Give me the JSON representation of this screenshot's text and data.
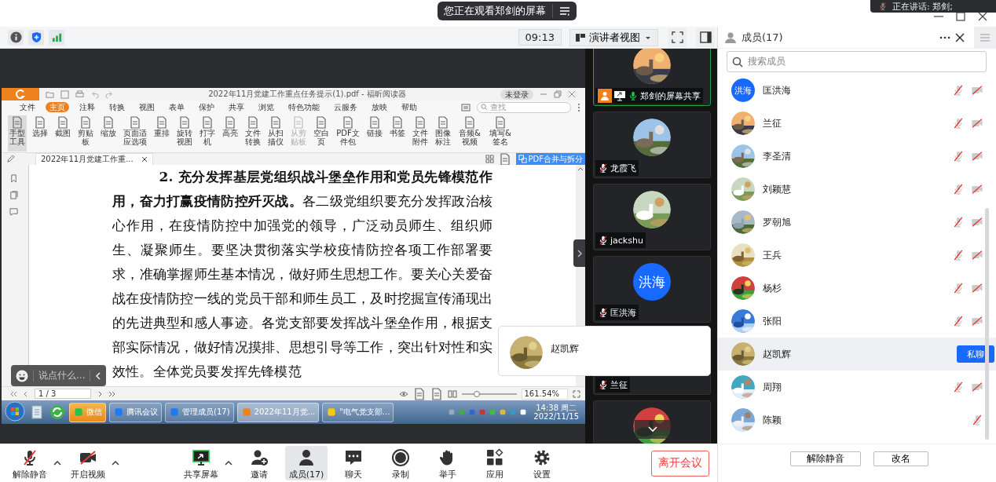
{
  "window": {
    "notice": "您正在观看郑剑的屏幕",
    "speaking": "正在讲话: 郑剑;"
  },
  "meeting_toolbar": {
    "timer": "09:13",
    "view_mode": "演讲者视图"
  },
  "shared_screen": {
    "reader": {
      "title": "2022年11月党建工作重点任务提示(1).pdf - 福昕阅读器",
      "login": "未登录",
      "menu_tabs": [
        {
          "label": "文件",
          "selected": false
        },
        {
          "label": "主页",
          "selected": true
        },
        {
          "label": "注释",
          "selected": false
        },
        {
          "label": "转换",
          "selected": false
        },
        {
          "label": "视图",
          "selected": false
        },
        {
          "label": "表单",
          "selected": false
        },
        {
          "label": "保护",
          "selected": false
        },
        {
          "label": "共享",
          "selected": false
        },
        {
          "label": "浏览",
          "selected": false
        },
        {
          "label": "特色功能",
          "selected": false
        },
        {
          "label": "云服务",
          "selected": false
        },
        {
          "label": "放映",
          "selected": false
        },
        {
          "label": "帮助",
          "selected": false
        }
      ],
      "search_placeholder": "查找",
      "tools": [
        {
          "label": "手型工具",
          "selected": true,
          "disabled": false
        },
        {
          "label": "选择",
          "selected": false,
          "disabled": false
        },
        {
          "label": "截图",
          "selected": false,
          "disabled": false
        },
        {
          "label": "剪贴板",
          "selected": false,
          "disabled": false
        },
        {
          "label": "缩放",
          "selected": false,
          "disabled": false
        },
        {
          "label": "页面适应选项",
          "selected": false,
          "disabled": false
        },
        {
          "label": "重排",
          "selected": false,
          "disabled": false
        },
        {
          "label": "旋转视图",
          "selected": false,
          "disabled": false
        },
        {
          "label": "打字机",
          "selected": false,
          "disabled": false
        },
        {
          "label": "高亮",
          "selected": false,
          "disabled": false
        },
        {
          "label": "文件转换",
          "selected": false,
          "disabled": false
        },
        {
          "label": "从扫描仪",
          "selected": false,
          "disabled": false
        },
        {
          "label": "从剪贴板",
          "selected": false,
          "disabled": true
        },
        {
          "label": "空白页",
          "selected": false,
          "disabled": false
        },
        {
          "label": "PDF文件包",
          "selected": false,
          "disabled": false
        },
        {
          "label": "链接",
          "selected": false,
          "disabled": false
        },
        {
          "label": "书签",
          "selected": false,
          "disabled": false
        },
        {
          "label": "文件附件",
          "selected": false,
          "disabled": false
        },
        {
          "label": "图像标注",
          "selected": false,
          "disabled": false
        },
        {
          "label": "音频&视频",
          "selected": false,
          "disabled": false
        },
        {
          "label": "填写&签名",
          "selected": false,
          "disabled": false
        }
      ],
      "document_tab": "2022年11月党建工作重...",
      "merge_button": "PDF合并与拆分",
      "paragraph": "**2. 充分发挥基层党组织战斗堡垒作用和党员先锋模范作用，奋力打赢疫情防控歼灭战。**各二级党组织要充分发挥政治核心作用，在疫情防控中加强党的领导，广泛动员师生、组织师生、凝聚师生。要坚决贯彻落实学校疫情防控各项工作部署要求，准确掌握师生基本情况，做好师生思想工作。要关心关爱奋战在疫情防控一线的党员干部和师生员工，及时挖掘宣传涌现出的先进典型和感人事迹。各党支部要发挥战斗堡垒作用，根据支部实际情况，做好情况摸排、思想引导等工作，突出针对性和实效性。全体党员要发挥先锋模范",
      "page": "1 / 3",
      "zoom_slider": {
        "level": 0.28
      },
      "zoom": "161.54%"
    },
    "taskbar": {
      "tasks": [
        {
          "label": "微信",
          "selected": false,
          "flashing": true
        },
        {
          "label": "腾讯会议",
          "selected": false,
          "flashing": false
        },
        {
          "label": "管理成员(17)",
          "selected": false,
          "flashing": false
        },
        {
          "label": "2022年11月党...",
          "selected": true,
          "flashing": false
        },
        {
          "label": "\"电气党支部...",
          "selected": false,
          "flashing": false
        }
      ],
      "time": "14:38 周二",
      "date": "2022/11/15"
    }
  },
  "chat_input": {
    "placeholder": "说点什么..."
  },
  "video_tiles": [
    {
      "name": "郑剑的屏幕共享",
      "kind": "screen-share",
      "muted": false,
      "covered": false
    },
    {
      "name": "龙霞飞",
      "kind": "member",
      "muted": true,
      "covered": false
    },
    {
      "name": "jackshu",
      "kind": "member",
      "muted": true,
      "covered": false
    },
    {
      "name": "匡洪海",
      "kind": "member",
      "muted": true,
      "covered": false,
      "avatar_text": "洪海"
    },
    {
      "name": "兰征",
      "kind": "member",
      "muted": true,
      "covered": true
    },
    {
      "kind": "member",
      "covered": false
    }
  ],
  "hover_card": {
    "name": "赵凯辉"
  },
  "members_panel": {
    "title": "成员(17)",
    "search_placeholder": "搜索成员",
    "members": [
      {
        "name": "匡洪海",
        "avatar_text": "洪海",
        "mic_muted": true,
        "video_off": true,
        "selected": false
      },
      {
        "name": "兰征",
        "mic_muted": true,
        "video_off": true,
        "selected": false
      },
      {
        "name": "李圣清",
        "mic_muted": true,
        "video_off": true,
        "selected": false
      },
      {
        "name": "刘颖慧",
        "mic_muted": true,
        "video_off": true,
        "selected": false
      },
      {
        "name": "罗朝旭",
        "mic_muted": true,
        "video_off": true,
        "selected": false
      },
      {
        "name": "王兵",
        "mic_muted": true,
        "video_off": true,
        "selected": false
      },
      {
        "name": "杨杉",
        "mic_muted": true,
        "video_off": true,
        "selected": false
      },
      {
        "name": "张阳",
        "mic_muted": true,
        "video_off": true,
        "selected": false
      },
      {
        "name": "赵凯辉",
        "mic_muted": false,
        "video_off": false,
        "selected": true,
        "action": "私聊"
      },
      {
        "name": "周翔",
        "mic_muted": true,
        "video_off": true,
        "selected": false
      },
      {
        "name": "陈颖",
        "mic_muted": true,
        "video_off": false,
        "selected": false
      }
    ],
    "buttons": [
      "解除静音",
      "改名"
    ]
  },
  "bottom_bar": {
    "items": [
      {
        "label": "解除静音",
        "kind": "mic",
        "muted": true,
        "caret": true,
        "selected": false
      },
      {
        "label": "开启视频",
        "kind": "video",
        "muted": true,
        "caret": true,
        "selected": false
      },
      {
        "label": "共享屏幕",
        "kind": "share",
        "caret": true,
        "selected": false
      },
      {
        "label": "邀请",
        "kind": "invite",
        "selected": false
      },
      {
        "label": "成员(17)",
        "kind": "members",
        "selected": true
      },
      {
        "label": "聊天",
        "kind": "chat",
        "selected": false
      },
      {
        "label": "录制",
        "kind": "record",
        "selected": false
      },
      {
        "label": "举手",
        "kind": "hand",
        "selected": false
      },
      {
        "label": "应用",
        "kind": "apps",
        "selected": false
      },
      {
        "label": "设置",
        "kind": "settings",
        "selected": false
      }
    ],
    "leave_button": "离开会议"
  }
}
